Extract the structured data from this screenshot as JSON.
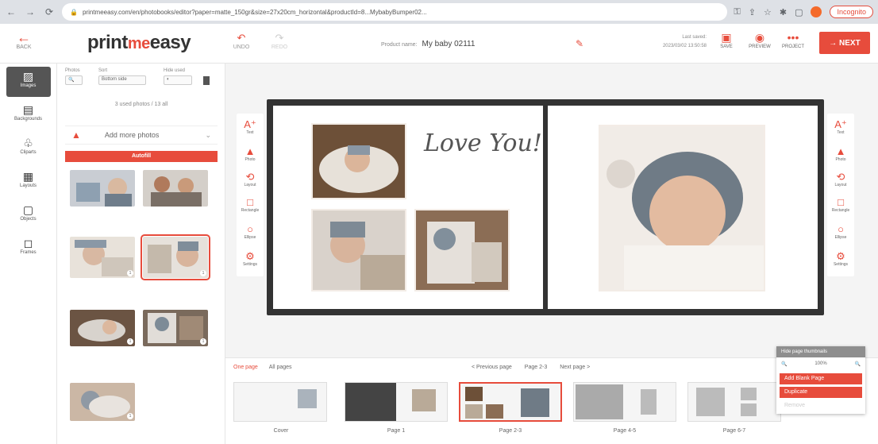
{
  "browser": {
    "url": "printmeeasy.com/en/photobooks/editor?paper=matte_150gr&size=27x20cm_horizontal&productId=8...MybabyBumper02...",
    "profile": "Incognito"
  },
  "header": {
    "back_label": "BACK",
    "logo_part1": "print",
    "logo_part2": "me",
    "logo_part3": "easy",
    "undo": "UNDO",
    "redo": "REDO",
    "project_name_label": "Product name:",
    "project_name": "My baby 02111",
    "saved_label": "Last saved:",
    "saved_time": "2023/03/02 13:50:58",
    "save": "SAVE",
    "preview": "PREVIEW",
    "project": "PROJECT",
    "next": "→ NEXT"
  },
  "rail": [
    "Images",
    "Backgrounds",
    "Cliparts",
    "Layouts",
    "Objects",
    "Frames"
  ],
  "photos_panel": {
    "filter_label": "Photos",
    "sort_label": "Sort",
    "sort_value": "Bottom side",
    "hide_label": "Hide used",
    "count_text": "3 used photos / 13 all",
    "add_more": "Add more photos",
    "autofill": "Autofill"
  },
  "tools_left": [
    "Text",
    "Photo",
    "Layout",
    "Rectangle",
    "Ellipse",
    "Settings"
  ],
  "tools_right": [
    "Text",
    "Photo",
    "Layout",
    "Rectangle",
    "Ellipse",
    "Settings"
  ],
  "spread": {
    "script_text": "Love You!"
  },
  "bottom": {
    "one_page": "One page",
    "all_pages": "All pages",
    "prev_page": "< Previous page",
    "current": "Page 2-3",
    "next_page": "Next page >",
    "pages": [
      "Cover",
      "Page 1",
      "Page 2-3",
      "Page 4-5",
      "Page 6-7"
    ]
  },
  "menu": {
    "header": "Hide page thumbnails",
    "zoom": "100%",
    "add_blank": "Add Blank Page",
    "duplicate": "Duplicate",
    "remove": "Remove"
  },
  "colors": {
    "accent": "#e74c3c",
    "spread_border": "#333333"
  }
}
